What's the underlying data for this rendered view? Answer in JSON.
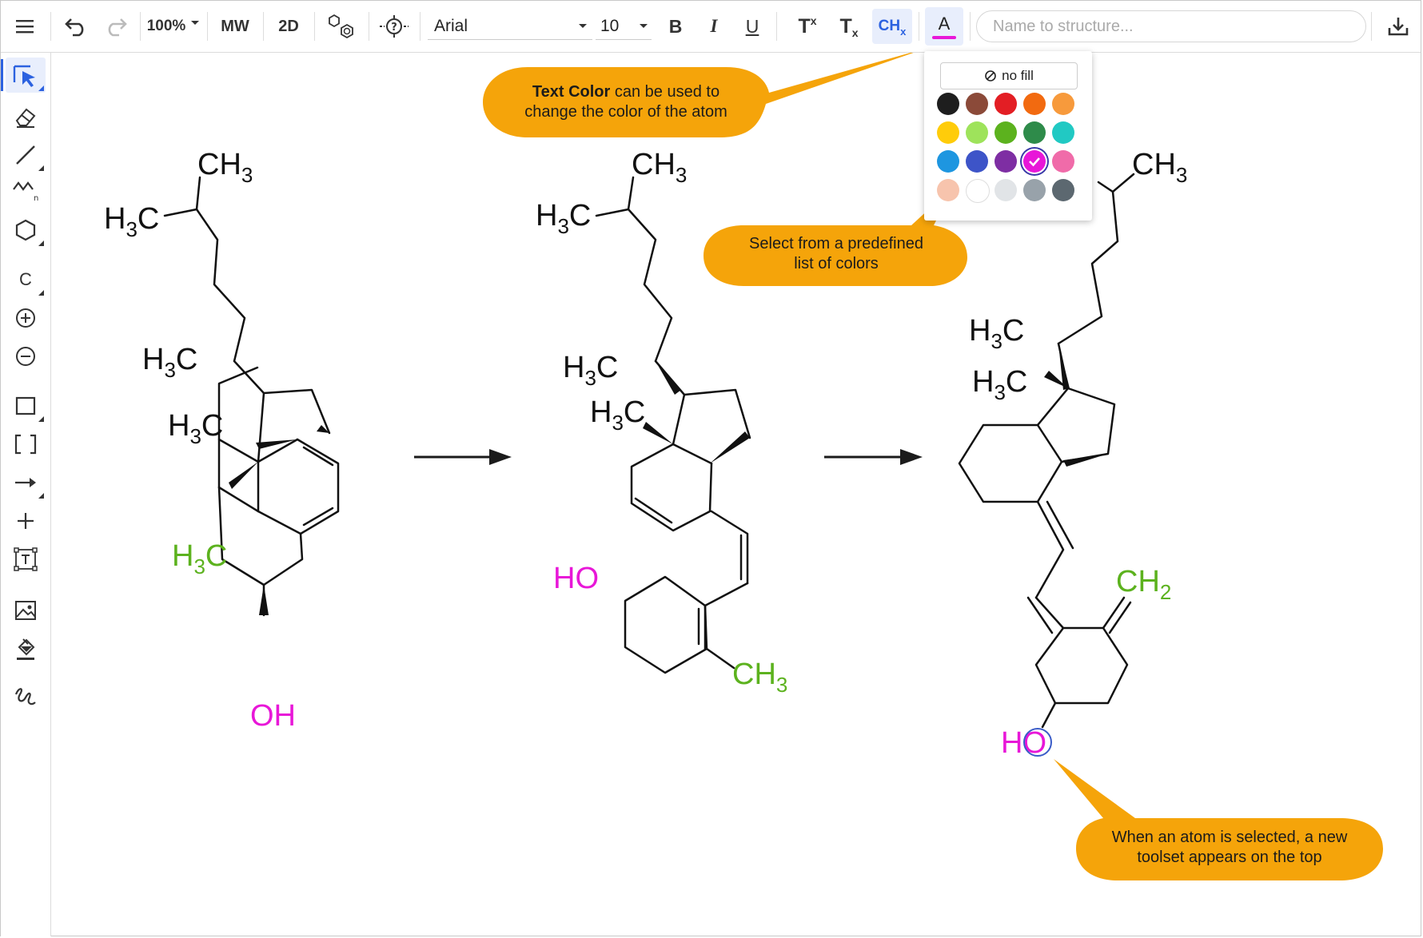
{
  "toolbar": {
    "zoom": "100%",
    "mw_label": "MW",
    "view_label": "2D",
    "font_family": "Arial",
    "font_size": "10",
    "bold_label": "B",
    "italic_label": "I",
    "underline_label": "U",
    "superscript_label": "T",
    "superscript_mark": "x",
    "subscript_label": "T",
    "subscript_mark": "x",
    "chx_label": "CH",
    "chx_sub": "x",
    "text_color_label": "A",
    "text_color_underline": "#e817d8",
    "search_placeholder": "Name to structure..."
  },
  "color_popup": {
    "no_fill_label": "no fill",
    "selected_color": "#e817d8",
    "colors": [
      [
        "#1e1e1e",
        "#8b4a39",
        "#e31e24",
        "#f26a10",
        "#f79a3c"
      ],
      [
        "#ffcc0a",
        "#9ee35b",
        "#5cb21e",
        "#2e8b4a",
        "#21c9c3"
      ],
      [
        "#1e96e0",
        "#3d54c8",
        "#7e2ea3",
        "#e817d8",
        "#f06ba9"
      ],
      [
        "#f7c4ad",
        "#ffffff",
        "#e1e4e7",
        "#98a2aa",
        "#5c6870"
      ]
    ]
  },
  "callouts": {
    "text_color_bold": "Text Color",
    "text_color_rest": " can be used to",
    "text_color_line2": "change the color of the atom",
    "predefined_line1": "Select from a predefined",
    "predefined_line2": "list of colors",
    "selected_line1": "When an atom is selected, a new",
    "selected_line2": "toolset appears on the top",
    "fill": "#f5a40a"
  },
  "molecule_labels": {
    "ch3": "CH",
    "h3c": "C",
    "h": "H",
    "sub3": "3",
    "sub2": "2",
    "oh": "OH",
    "ho": "HO",
    "ch2": "CH",
    "atom_green": "#5cb21e",
    "atom_magenta": "#e817d8"
  }
}
